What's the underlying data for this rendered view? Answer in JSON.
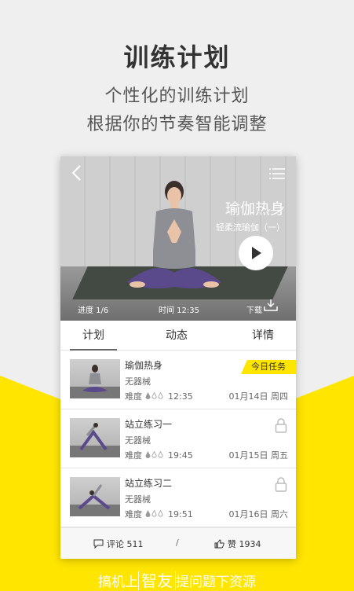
{
  "promo": {
    "title": "训练计划",
    "subtitle_line1": "个性化的训练计划",
    "subtitle_line2": "根据你的节奏智能调整"
  },
  "colors": {
    "accent": "#ffe500",
    "background": "#efefef"
  },
  "hero": {
    "title": "瑜伽热身",
    "subtitle": "轻柔流瑜伽（一）",
    "progress": "进度 1/6",
    "time": "时间 12:35",
    "download_label": "下载",
    "icons": [
      "back-icon",
      "menu-icon",
      "play-icon",
      "download-icon"
    ]
  },
  "tabs": [
    {
      "label": "计划",
      "active": true
    },
    {
      "label": "动态",
      "active": false
    },
    {
      "label": "详情",
      "active": false
    }
  ],
  "items": [
    {
      "title": "瑜伽热身",
      "equipment": "无器械",
      "difficulty_label": "难度",
      "difficulty_level": 1,
      "duration": "12:35",
      "date": "01月14日 周四",
      "badge": "今日任务",
      "locked": false
    },
    {
      "title": "站立练习一",
      "equipment": "无器械",
      "difficulty_label": "难度",
      "difficulty_level": 1,
      "duration": "19:45",
      "date": "01月15日 周五",
      "badge": "",
      "locked": true
    },
    {
      "title": "站立练习二",
      "equipment": "无器械",
      "difficulty_label": "难度",
      "difficulty_level": 1,
      "duration": "19:51",
      "date": "01月16日 周六",
      "badge": "",
      "locked": true
    }
  ],
  "footer": {
    "comments": "评论 511",
    "separator": "/",
    "likes": "赞 1934"
  },
  "watermark": {
    "prefix": "搞机上",
    "highlight": "智友",
    "suffix": "提问题下资源"
  }
}
